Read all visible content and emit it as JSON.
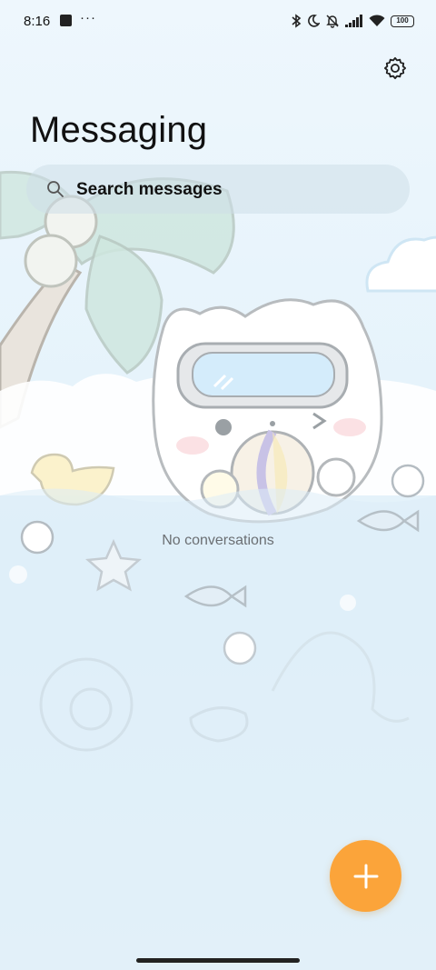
{
  "status_bar": {
    "time": "8:16",
    "more": "···",
    "battery": "100",
    "icons": [
      "bluetooth-icon",
      "moon-icon",
      "bell-off-icon",
      "signal-icon",
      "wifi-icon",
      "battery-icon"
    ]
  },
  "header": {
    "title": "Messaging",
    "settings_icon": "gear-icon"
  },
  "search": {
    "placeholder": "Search messages",
    "icon": "search-icon"
  },
  "empty_state": {
    "message": "No conversations"
  },
  "fab": {
    "icon": "plus-icon",
    "color": "#fba43a"
  },
  "colors": {
    "background": "#eaf5fc",
    "accent": "#fba43a"
  }
}
